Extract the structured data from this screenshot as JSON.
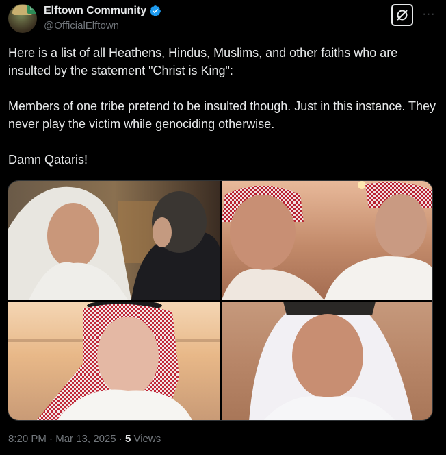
{
  "account": {
    "display_name": "Elftown Community",
    "handle": "@OfficialElftown",
    "avatar_badge": "L",
    "verified": true,
    "verified_color": "#1d9bf0"
  },
  "post": {
    "text": "Here is a list of all Heathens, Hindus, Muslims, and other faiths who are insulted by the statement \"Christ is King\":\n\nMembers of one tribe pretend to be insulted though. Just in this instance. They never play the victim while genociding otherwise.\n\nDamn Qataris!"
  },
  "media": {
    "images": [
      {
        "icon": "photo-man-white-headdress-with-man-in-suit"
      },
      {
        "icon": "photo-two-men-red-checkered-headdress-desert"
      },
      {
        "icon": "photo-old-man-red-checkered-keffiyeh-desert"
      },
      {
        "icon": "photo-man-white-headdress-desert"
      }
    ]
  },
  "footer": {
    "time": "8:20 PM",
    "separator": "·",
    "date": "Mar 13, 2025",
    "views_count": "5",
    "views_label": "Views"
  },
  "actions": {
    "grok_icon": "grok-icon",
    "more_icon": "more-options-icon",
    "more_glyph": "···"
  },
  "colors": {
    "background": "#000000",
    "text": "#e7e9ea",
    "muted": "#71767b",
    "accent": "#1d9bf0"
  }
}
